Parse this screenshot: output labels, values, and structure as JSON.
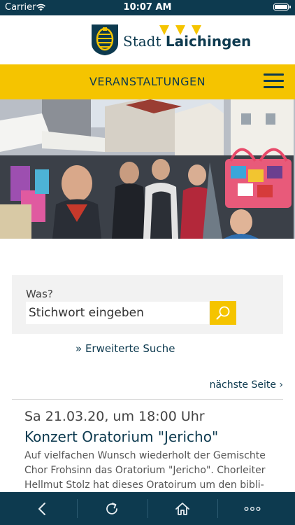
{
  "status_bar": {
    "carrier": "Carrier",
    "time": "10:07 AM"
  },
  "brand": {
    "name_light": "Stadt ",
    "name_bold": "Laichingen"
  },
  "navbar": {
    "title": "VERANSTALTUNGEN"
  },
  "search": {
    "label": "Was?",
    "placeholder": "Stichwort eingeben"
  },
  "advanced_search": "» Erweiterte Suche",
  "next_page": "nächste Seite ›",
  "event": {
    "date": "Sa 21.03.20, um 18:00 Uhr",
    "title": "Konzert Oratorium \"Jericho\"",
    "description": "Auf vielfachen Wunsch wiederholt der Gemischte Chor Frohsinn das Oratorium \"Jericho\". Chorleiter Hellmut Stolz hat dieses Oratoirum um den bibli-"
  },
  "colors": {
    "accent": "#f5c400",
    "dark": "#0d3a4f"
  },
  "toolbar": {
    "icons": [
      "back-icon",
      "reload-icon",
      "home-icon",
      "more-icon"
    ]
  }
}
